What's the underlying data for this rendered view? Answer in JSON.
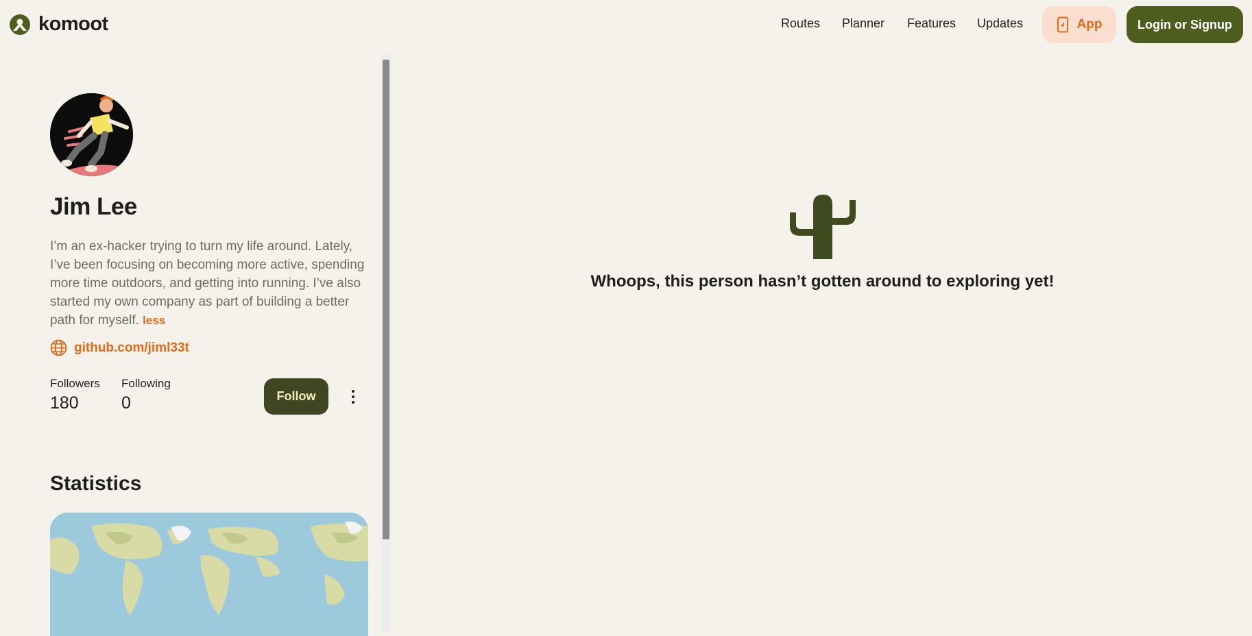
{
  "header": {
    "logo_text": "komoot",
    "nav": [
      "Routes",
      "Planner",
      "Features",
      "Updates"
    ],
    "app_label": "App",
    "login_label": "Login or Signup"
  },
  "profile": {
    "name": "Jim Lee",
    "bio": "I’m an ex-hacker trying to turn my life around. Lately, I’ve been focusing on becoming more active, spending more time outdoors, and getting into running. I’ve also started my own company as part of building a better path for myself.",
    "less_label": "less",
    "website": "github.com/jiml33t",
    "followers_label": "Followers",
    "followers_count": "180",
    "following_label": "Following",
    "following_count": "0",
    "follow_label": "Follow"
  },
  "statistics": {
    "title": "Statistics"
  },
  "main": {
    "empty_message": "Whoops, this person hasn’t gotten around to exploring yet!"
  },
  "colors": {
    "background": "#f5f2eb",
    "brand_green": "#4e5d1d",
    "follow_green": "#3f4621",
    "accent_orange": "#e06a16",
    "app_bg": "#fadfd0"
  },
  "icons": [
    "komoot-logo-icon",
    "phone-icon",
    "globe-icon",
    "more-vertical-icon",
    "cactus-icon"
  ]
}
